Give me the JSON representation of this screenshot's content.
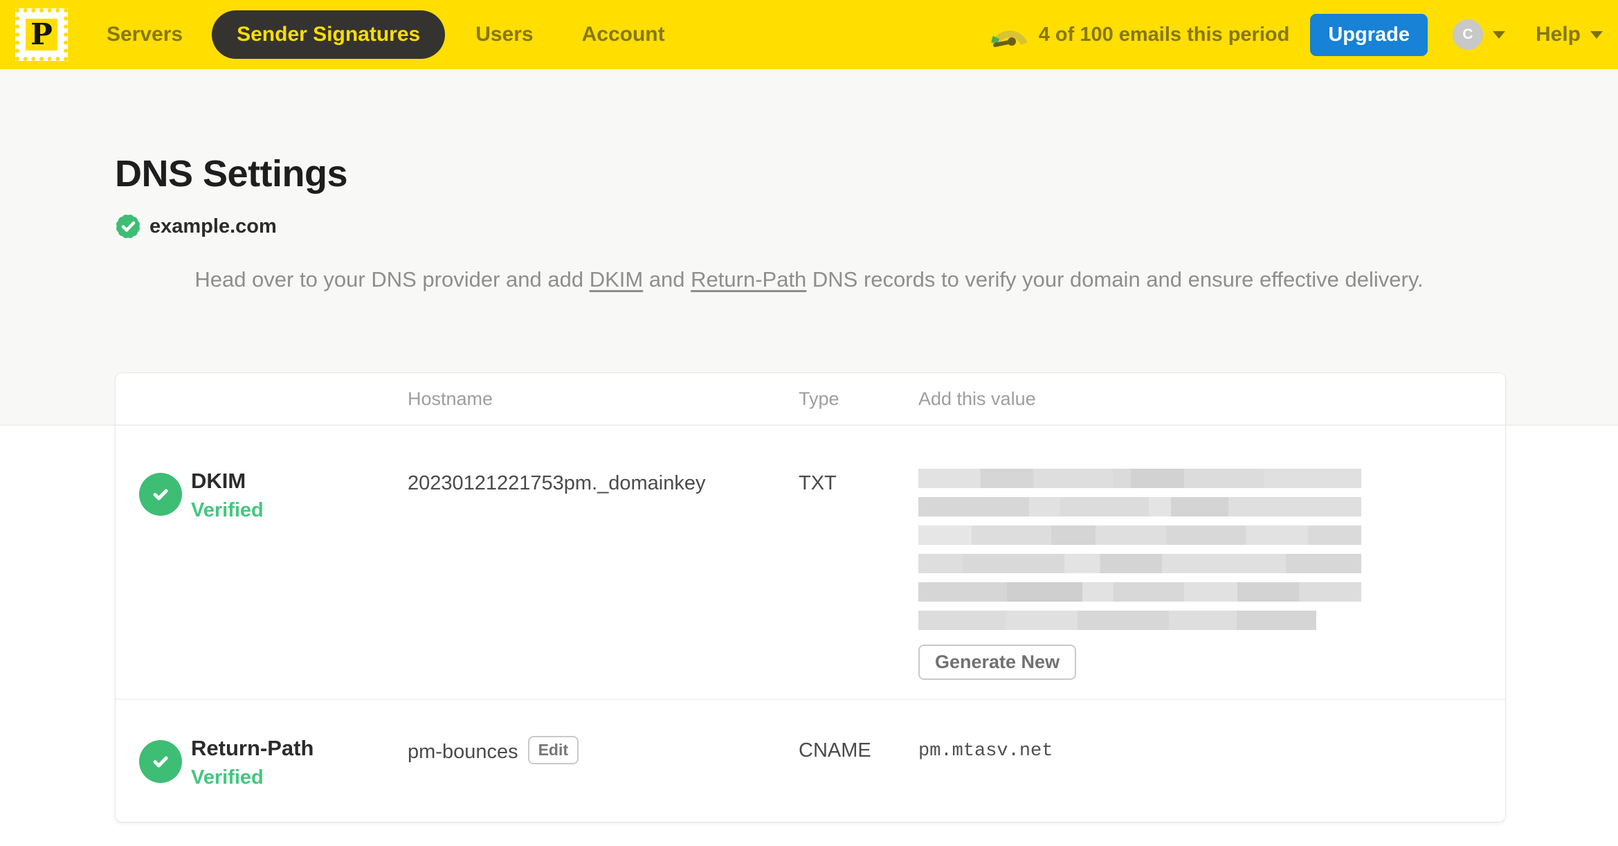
{
  "nav": {
    "logo_letter": "P",
    "items": [
      {
        "label": "Servers",
        "active": false
      },
      {
        "label": "Sender Signatures",
        "active": true
      },
      {
        "label": "Users",
        "active": false
      },
      {
        "label": "Account",
        "active": false
      }
    ],
    "usage_text": "4 of 100 emails this period",
    "upgrade_label": "Upgrade",
    "avatar_initial": "C",
    "help_label": "Help"
  },
  "page": {
    "title": "DNS Settings",
    "domain": "example.com",
    "description": {
      "pre": "Head over to your DNS provider and add ",
      "link1": "DKIM",
      "mid": " and ",
      "link2": "Return-Path",
      "post": " DNS records to verify your domain and ensure effective delivery."
    }
  },
  "table": {
    "headers": {
      "hostname": "Hostname",
      "type": "Type",
      "value": "Add this value"
    },
    "rows": [
      {
        "name": "DKIM",
        "status": "Verified",
        "hostname": "20230121221753pm._domainkey",
        "type": "TXT",
        "value_redacted": true,
        "action_label": "Generate New"
      },
      {
        "name": "Return-Path",
        "status": "Verified",
        "hostname": "pm-bounces",
        "edit_label": "Edit",
        "type": "CNAME",
        "value": "pm.mtasv.net"
      }
    ]
  },
  "colors": {
    "brand_yellow": "#FFDE00",
    "nav_text_olive": "#857713",
    "active_pill_bg": "#343330",
    "upgrade_blue": "#1782D6",
    "verified_green": "#3EBD75",
    "verified_text_green": "#43C77F",
    "hero_bg": "#F8F8F7"
  }
}
